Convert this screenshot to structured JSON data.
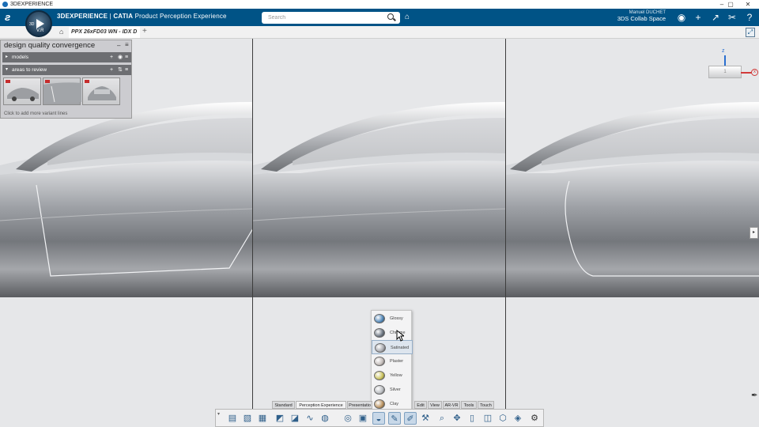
{
  "window": {
    "title": "3DEXPERIENCE",
    "controls": [
      "–",
      "▢",
      "✕"
    ]
  },
  "topbar": {
    "brand_bold": "3DEXPERIENCE",
    "brand_sep": " | ",
    "brand_app": "CATIA",
    "brand_suffix": " Product Perception Experience",
    "compass_version": "V.R",
    "compass_label": "3D",
    "search_placeholder": "Search",
    "user_name": "Manuel DUCHET",
    "collab_space": "3DS Collab Space ⌄",
    "icons": [
      "user-icon",
      "plus-icon",
      "share-icon",
      "tools-icon",
      "help-icon"
    ]
  },
  "tabs": {
    "document_tab": "PPX 26xFD03 WN - IDX D",
    "add_tab": "+"
  },
  "panel": {
    "title": "design quality convergence",
    "models_label": "models",
    "areas_label": "areas to review",
    "add_variant": "Click to add more variant lines"
  },
  "triad": {
    "z_label": "z",
    "x_label": "x",
    "box_label": "1"
  },
  "material_menu": {
    "items": [
      {
        "label": "Glossy",
        "color": "#4f86b8"
      },
      {
        "label": "Chrome",
        "color": "#6a7480"
      },
      {
        "label": "Satinated",
        "color": "#a7a8ae"
      },
      {
        "label": "Plaster",
        "color": "#c2bbb8"
      },
      {
        "label": "Yellow",
        "color": "#c9c15a"
      },
      {
        "label": "Silver",
        "color": "#b9bcc0"
      },
      {
        "label": "Clay",
        "color": "#b9915e"
      }
    ],
    "active_index": 2
  },
  "category_tabs": [
    "Standard",
    "Perception Experience",
    "Presentatio",
    "Edit",
    "View",
    "AR-VR",
    "Tools",
    "Touch"
  ],
  "active_category": 1,
  "action_bar": {
    "tools": [
      "properties-icon",
      "layer-icon",
      "table-icon",
      "shade-icon",
      "display-icon",
      "curve-icon",
      "sphere-icon",
      "environment-icon",
      "catalog-icon",
      "material-icon",
      "paint-icon",
      "light-icon",
      "measure-icon",
      "zoom-icon",
      "explode-icon",
      "filter-icon",
      "section-icon",
      "view-cube-icon",
      "render-icon",
      "settings-icon"
    ],
    "active_tools": [
      9,
      10,
      11
    ]
  },
  "colors": {
    "brand_blue": "#005386",
    "highlight": "#c8d8e8"
  }
}
